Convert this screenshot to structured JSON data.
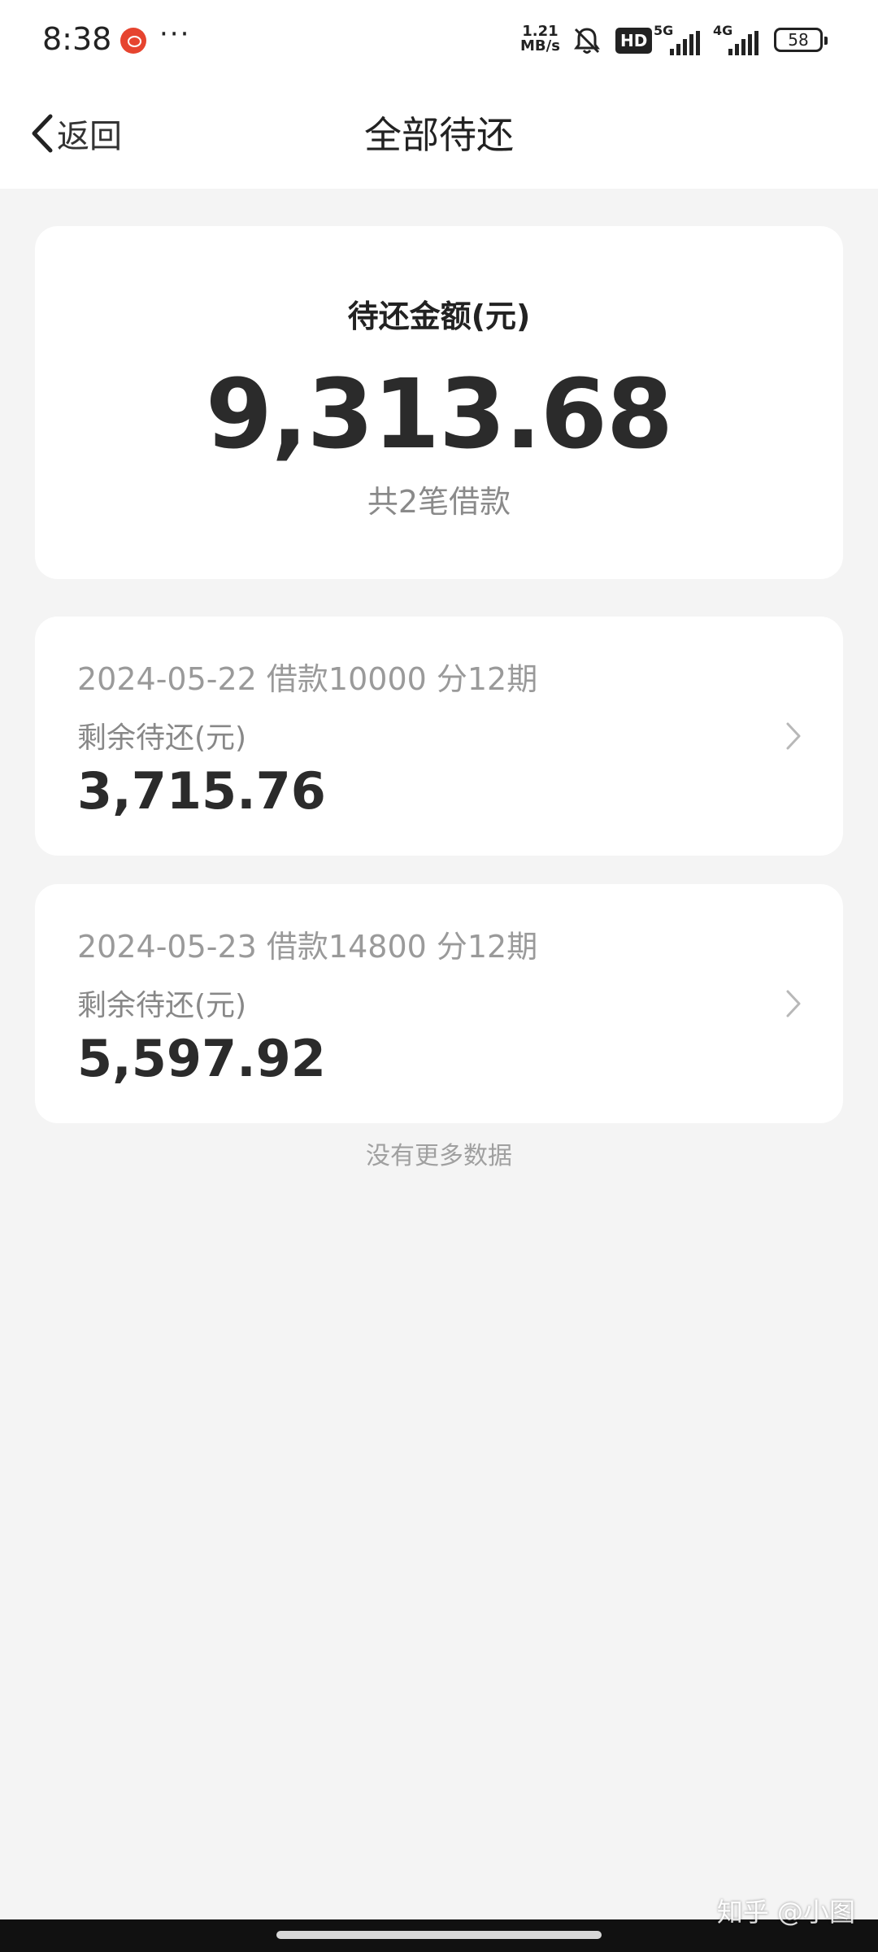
{
  "status_bar": {
    "time": "8:38",
    "dots": "···",
    "speed_value": "1.21",
    "speed_unit": "MB/s",
    "hd_label": "HD",
    "net1": "5G",
    "net2": "4G",
    "battery": "58"
  },
  "nav": {
    "back_label": "返回",
    "title": "全部待还"
  },
  "summary": {
    "label": "待还金额(元)",
    "amount": "9,313.68",
    "count_text": "共2笔借款"
  },
  "loans": [
    {
      "title": "2024-05-22 借款10000 分12期",
      "sub_label": "剩余待还(元)",
      "amount": "3,715.76"
    },
    {
      "title": "2024-05-23 借款14800 分12期",
      "sub_label": "剩余待还(元)",
      "amount": "5,597.92"
    }
  ],
  "footer": {
    "no_more": "没有更多数据"
  },
  "watermark": "知乎 @小图",
  "colors": {
    "background": "#f4f4f4",
    "card": "#ffffff",
    "primary_text": "#2b2b2b",
    "secondary_text": "#9a9a9a",
    "weibo_red": "#e6442f"
  }
}
